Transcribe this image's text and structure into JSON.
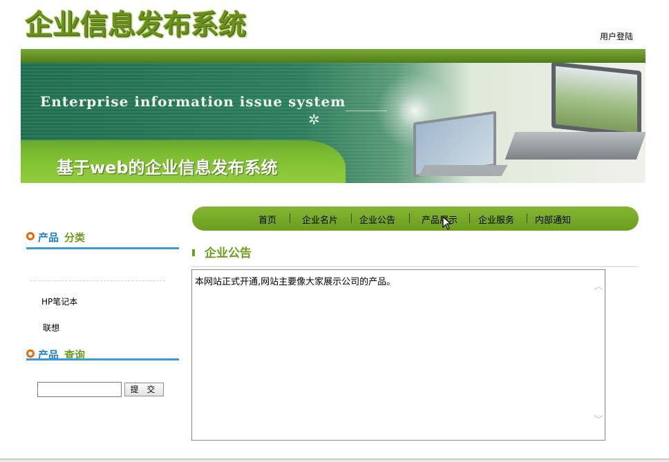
{
  "header": {
    "logo_text": "企业信息发布系统",
    "login_label": "用户登陆"
  },
  "banner": {
    "english_title": "Enterprise information issue system",
    "chinese_subtitle": "基于web的企业信息发布系统"
  },
  "nav": {
    "items": [
      "首页",
      "企业名片",
      "企业公告",
      "产品展示",
      "企业服务",
      "内部通知"
    ]
  },
  "sidebar": {
    "categories_title_a": "产品",
    "categories_title_b": "分类",
    "categories": [
      "HP笔记本",
      "联想"
    ],
    "search_title_a": "产品",
    "search_title_b": "查询",
    "search_input_value": "",
    "submit_label": "提 交"
  },
  "main": {
    "section_title": "企业公告",
    "announcement_text": "本网站正式开通,网站主要像大家展示公司的产品。"
  },
  "colors": {
    "accent_green": "#6a9e1c",
    "rule_blue": "#3a9ad9",
    "icon_orange": "#e36b0a",
    "title_blue": "#1a7fc7",
    "title_green": "#6a9e1c"
  }
}
